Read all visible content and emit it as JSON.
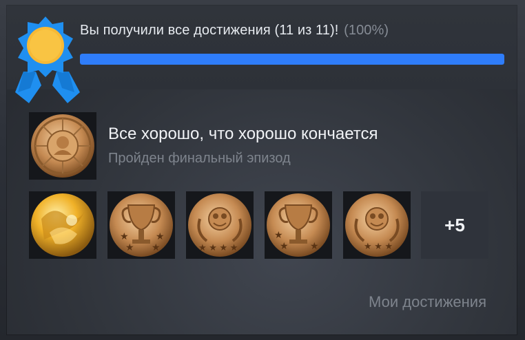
{
  "progress": {
    "message": "Вы получили все достижения (11 из 11)!",
    "percent_label": "(100%)",
    "fraction": 1.0
  },
  "featured_achievement": {
    "title": "Все хорошо, что хорошо кончается",
    "description": "Пройден финальный эпизод",
    "icon": "bronze-medal-emblem-icon"
  },
  "achievement_icons": [
    {
      "icon": "gold-abstract-medal-icon"
    },
    {
      "icon": "bronze-trophy-cup-icon"
    },
    {
      "icon": "bronze-laurel-emblem-icon"
    },
    {
      "icon": "bronze-trophy-cup-icon"
    },
    {
      "icon": "bronze-laurel-emblem-icon"
    }
  ],
  "more_count_label": "+5",
  "footer": {
    "my_achievements_link": "Мои достижения"
  },
  "colors": {
    "accent_blue": "#2f7dfa",
    "ribbon_blue": "#1f8ff0",
    "medal_gold": "#f6b935"
  }
}
